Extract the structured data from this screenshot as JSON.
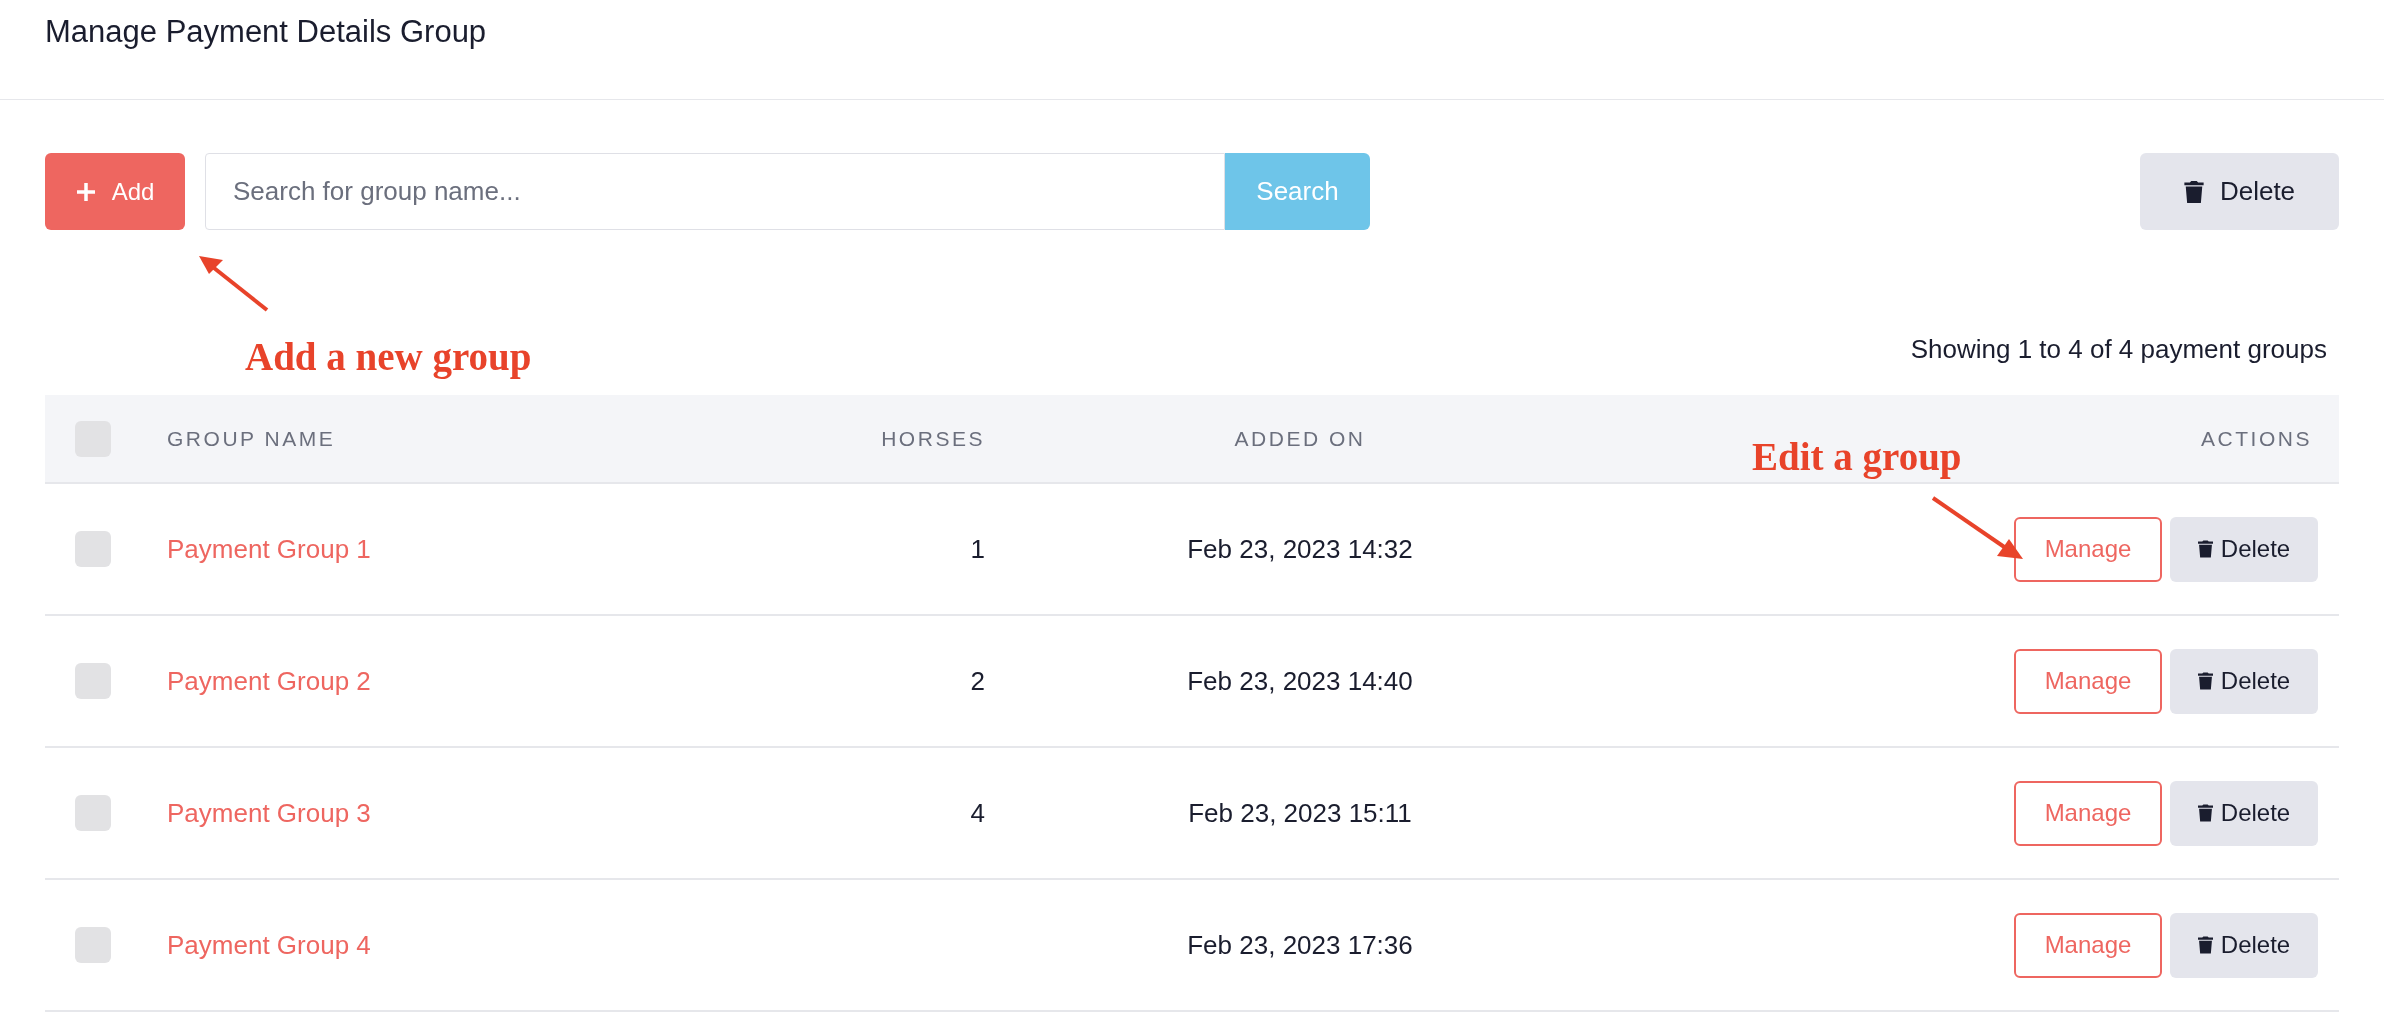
{
  "page": {
    "title": "Manage Payment Details Group"
  },
  "toolbar": {
    "add_button": "Add",
    "search": {
      "placeholder": "Search for group name..."
    },
    "search_button": "Search",
    "delete_button": "Delete"
  },
  "summary": "Showing 1 to 4 of 4 payment groups",
  "table": {
    "select_all": {
      "checked": false
    },
    "columns": [
      "GROUP NAME",
      "HORSES",
      "ADDED ON",
      "ACTIONS"
    ],
    "rows": [
      {
        "checked": false,
        "name": "Payment Group 1",
        "horses": "1",
        "added_on": "Feb 23, 2023 14:32",
        "manage": "Manage",
        "delete": "Delete"
      },
      {
        "checked": false,
        "name": "Payment Group 2",
        "horses": "2",
        "added_on": "Feb 23, 2023 14:40",
        "manage": "Manage",
        "delete": "Delete"
      },
      {
        "checked": false,
        "name": "Payment Group 3",
        "horses": "4",
        "added_on": "Feb 23, 2023 15:11",
        "manage": "Manage",
        "delete": "Delete"
      },
      {
        "checked": false,
        "name": "Payment Group 4",
        "added_on": "Feb 23, 2023 17:36",
        "manage": "Manage",
        "delete": "Delete"
      }
    ]
  },
  "annotations": [
    {
      "text": "Add a new group"
    },
    {
      "text": "Edit a group"
    }
  ]
}
